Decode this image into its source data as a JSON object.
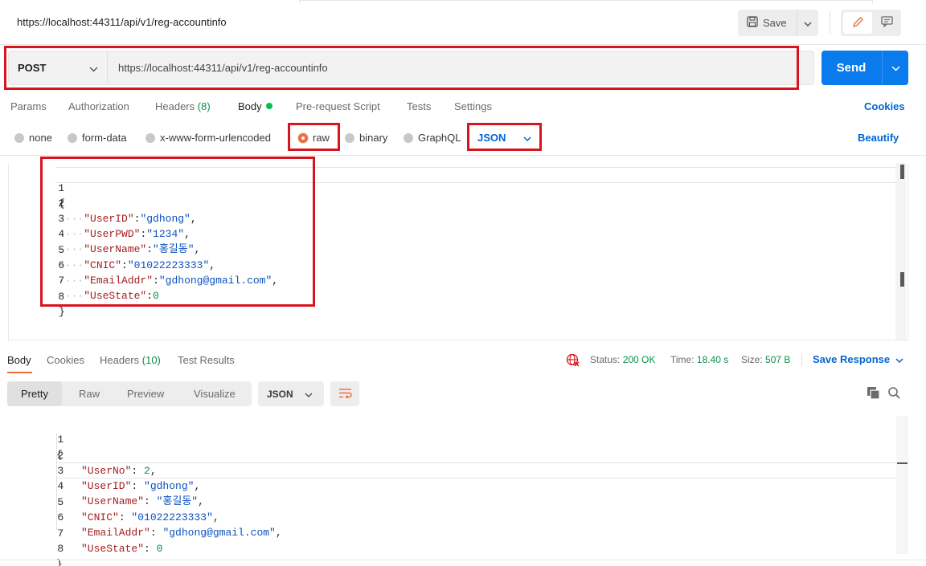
{
  "request": {
    "title": "https://localhost:44311/api/v1/reg-accountinfo",
    "save_label": "Save",
    "method": "POST",
    "url": "https://localhost:44311/api/v1/reg-accountinfo",
    "send_label": "Send"
  },
  "req_tabs": {
    "params": "Params",
    "authorization": "Authorization",
    "headers": "Headers",
    "headers_count": "(8)",
    "body": "Body",
    "prerequest": "Pre-request Script",
    "tests": "Tests",
    "settings": "Settings",
    "cookies_link": "Cookies"
  },
  "body_options": {
    "none": "none",
    "form_data": "form-data",
    "urlencoded": "x-www-form-urlencoded",
    "raw": "raw",
    "binary": "binary",
    "graphql": "GraphQL",
    "format": "JSON",
    "beautify": "Beautify",
    "selected": "raw"
  },
  "request_body": {
    "line_numbers": [
      "1",
      "2",
      "3",
      "4",
      "5",
      "6",
      "7",
      "8"
    ],
    "l1": "{",
    "l2_key": "\"UserID\"",
    "l2_val": "\"gdhong\"",
    "l3_key": "\"UserPWD\"",
    "l3_val": "\"1234\"",
    "l4_key": "\"UserName\"",
    "l4_val": "\"홍길동\"",
    "l5_key": "\"CNIC\"",
    "l5_val": "\"01022223333\"",
    "l6_key": "\"EmailAddr\"",
    "l6_val": "\"gdhong@gmail.com\"",
    "l7_key": "\"UseState\"",
    "l7_val": "0",
    "l8": "}"
  },
  "response": {
    "tabs": {
      "body": "Body",
      "cookies": "Cookies",
      "headers": "Headers",
      "headers_count": "(10)",
      "test_results": "Test Results"
    },
    "status_label": "Status:",
    "status_value": "200 OK",
    "time_label": "Time:",
    "time_value": "18.40 s",
    "size_label": "Size:",
    "size_value": "507 B",
    "save_response": "Save Response",
    "views": {
      "pretty": "Pretty",
      "raw": "Raw",
      "preview": "Preview",
      "visualize": "Visualize"
    },
    "format": "JSON",
    "body": {
      "line_numbers": [
        "1",
        "2",
        "3",
        "4",
        "5",
        "6",
        "7",
        "8"
      ],
      "l1": "{",
      "l2_key": "\"UserNo\"",
      "l2_val": "2",
      "l3_key": "\"UserID\"",
      "l3_val": "\"gdhong\"",
      "l4_key": "\"UserName\"",
      "l4_val": "\"홍길동\"",
      "l5_key": "\"CNIC\"",
      "l5_val": "\"01022223333\"",
      "l6_key": "\"EmailAddr\"",
      "l6_val": "\"gdhong@gmail.com\"",
      "l7_key": "\"UseState\"",
      "l7_val": "0",
      "l8": "}"
    }
  },
  "colors": {
    "accent_orange": "#f26b3a",
    "send_blue": "#097bed",
    "link_blue": "#0265d2",
    "status_green": "#0a8f4a",
    "highlight_red": "#d8141e"
  },
  "icons": {
    "save": "floppy-disk-icon",
    "edit": "pencil-icon",
    "comment": "comment-icon",
    "globe": "globe-icon",
    "wrap": "wrap-lines-icon",
    "copy": "copy-icon",
    "search": "search-icon"
  }
}
